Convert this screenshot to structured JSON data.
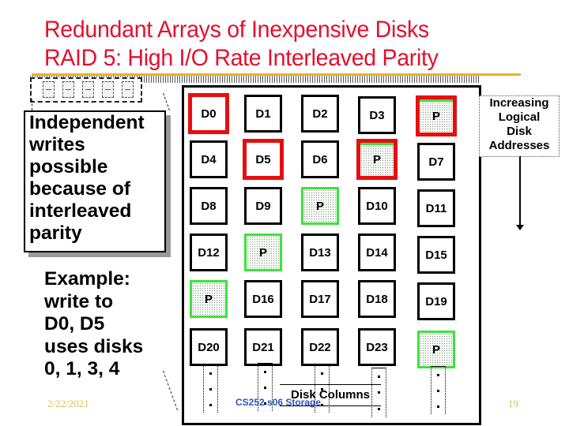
{
  "slide": {
    "title_line1": "Redundant Arrays of Inexpensive Disks",
    "title_line2": "RAID 5: High I/O Rate Interleaved Parity",
    "accent_color": "#e3102e",
    "rule_color": "#e8b227"
  },
  "left_panel": {
    "callout_lines": [
      "Independent",
      "writes",
      "possible",
      "because of",
      "interleaved",
      "parity"
    ],
    "example_lines": [
      "Example:",
      "write to",
      "D0, D5",
      "uses disks",
      "0, 1, 3, 4"
    ]
  },
  "disk_icons": [
    "disk-0",
    "disk-1",
    "disk-2",
    "disk-3",
    "disk-4"
  ],
  "grid": {
    "rows": [
      [
        {
          "label": "D0",
          "highlight": true,
          "parity": false
        },
        {
          "label": "D1",
          "highlight": false,
          "parity": false
        },
        {
          "label": "D2",
          "highlight": false,
          "parity": false
        },
        {
          "label": "D3",
          "highlight": false,
          "parity": false
        },
        {
          "label": "P",
          "highlight": true,
          "parity": true
        }
      ],
      [
        {
          "label": "D4",
          "highlight": false,
          "parity": false
        },
        {
          "label": "D5",
          "highlight": true,
          "parity": false
        },
        {
          "label": "D6",
          "highlight": false,
          "parity": false
        },
        {
          "label": "P",
          "highlight": true,
          "parity": true
        },
        {
          "label": "D7",
          "highlight": false,
          "parity": false
        }
      ],
      [
        {
          "label": "D8",
          "highlight": false,
          "parity": false
        },
        {
          "label": "D9",
          "highlight": false,
          "parity": false
        },
        {
          "label": "P",
          "highlight": false,
          "parity": true
        },
        {
          "label": "D10",
          "highlight": false,
          "parity": false
        },
        {
          "label": "D11",
          "highlight": false,
          "parity": false
        }
      ],
      [
        {
          "label": "D12",
          "highlight": false,
          "parity": false
        },
        {
          "label": "P",
          "highlight": false,
          "parity": true
        },
        {
          "label": "D13",
          "highlight": false,
          "parity": false
        },
        {
          "label": "D14",
          "highlight": false,
          "parity": false
        },
        {
          "label": "D15",
          "highlight": false,
          "parity": false
        }
      ],
      [
        {
          "label": "P",
          "highlight": false,
          "parity": true
        },
        {
          "label": "D16",
          "highlight": false,
          "parity": false
        },
        {
          "label": "D17",
          "highlight": false,
          "parity": false
        },
        {
          "label": "D18",
          "highlight": false,
          "parity": false
        },
        {
          "label": "D19",
          "highlight": false,
          "parity": false
        }
      ],
      [
        {
          "label": "D20",
          "highlight": false,
          "parity": false
        },
        {
          "label": "D21",
          "highlight": false,
          "parity": false
        },
        {
          "label": "D22",
          "highlight": false,
          "parity": false
        },
        {
          "label": "D23",
          "highlight": false,
          "parity": false
        },
        {
          "label": "P",
          "highlight": false,
          "parity": true
        }
      ]
    ],
    "highlight_color": "#e60f0f",
    "parity_color": "#3de23d",
    "disk_columns_label": "Disk Columns",
    "continuation": "..."
  },
  "addresses_label": {
    "lines": [
      "Increasing",
      "Logical",
      "Disk",
      "Addresses"
    ]
  },
  "footer": {
    "date": "2/22/2021",
    "course": "CS252 s06 Storage",
    "page_number": "19"
  }
}
